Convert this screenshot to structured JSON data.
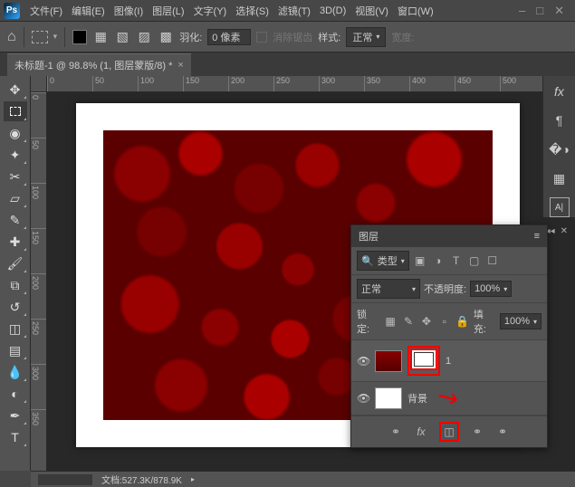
{
  "menu": {
    "items": [
      "文件(F)",
      "编辑(E)",
      "图像(I)",
      "图层(L)",
      "文字(Y)",
      "选择(S)",
      "滤镜(T)",
      "3D(D)",
      "视图(V)",
      "窗口(W)"
    ]
  },
  "options": {
    "feather_label": "羽化:",
    "feather_value": "0 像素",
    "antialias_label": "消除锯齿",
    "style_label": "样式:",
    "style_value": "正常",
    "width_label": "宽度:"
  },
  "tab": {
    "title": "未标题-1 @ 98.8% (1, 图层蒙版/8) *"
  },
  "ruler_h": [
    "0",
    "50",
    "100",
    "150",
    "200",
    "250",
    "300",
    "350",
    "400",
    "450",
    "500"
  ],
  "ruler_v": [
    "0",
    "50",
    "100",
    "150",
    "200",
    "250",
    "300",
    "350"
  ],
  "layers": {
    "title": "图层",
    "filter_label": "类型",
    "blend_mode": "正常",
    "opacity_label": "不透明度:",
    "opacity_value": "100%",
    "lock_label": "锁定:",
    "fill_label": "填充:",
    "fill_value": "100%",
    "layer1_name": "1",
    "layer2_name": "背景"
  },
  "status": {
    "doc_size": "文档:527.3K/878.9K"
  },
  "icons": {
    "search": "🔍"
  }
}
